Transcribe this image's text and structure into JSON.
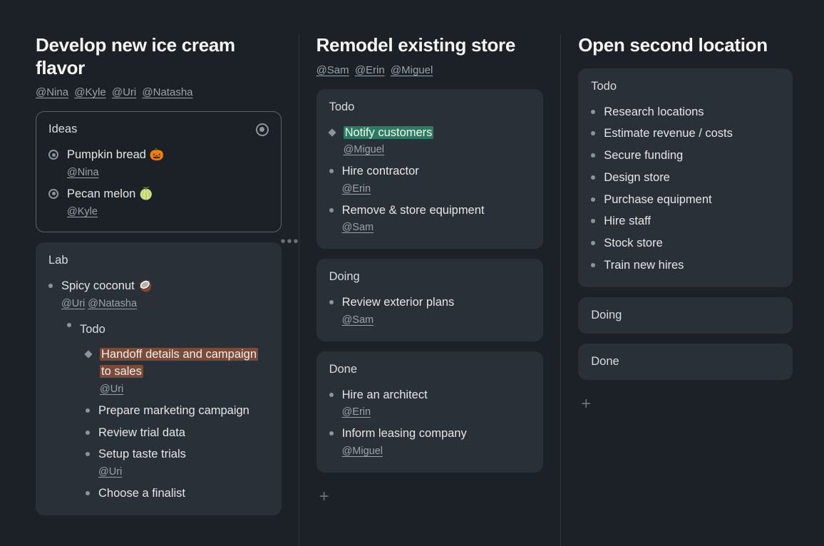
{
  "columns": [
    {
      "title": "Develop new ice cream flavor",
      "assignees": [
        "@Nina",
        "@Kyle",
        "@Uri",
        "@Natasha"
      ],
      "cards": [
        {
          "kind": "selected",
          "header": "Ideas",
          "header_focus": true,
          "items": [
            {
              "marker": "radio",
              "text": "Pumpkin bread 🎃",
              "assignees": [
                "@Nina"
              ]
            },
            {
              "marker": "radio",
              "text": "Pecan melon 🍈",
              "assignees": [
                "@Kyle"
              ]
            }
          ]
        },
        {
          "kind": "normal",
          "header": "Lab",
          "items": [
            {
              "marker": "bullet",
              "text": "Spicy coconut 🥥",
              "assignees": [
                "@Uri",
                "@Natasha"
              ],
              "children_header": "Todo",
              "children": [
                {
                  "marker": "diamond",
                  "text": "Handoff details and campaign to sales",
                  "highlight": "brown",
                  "assignees": [
                    "@Uri"
                  ]
                },
                {
                  "marker": "bullet",
                  "text": "Prepare marketing campaign"
                },
                {
                  "marker": "bullet",
                  "text": "Review trial data"
                },
                {
                  "marker": "bullet",
                  "text": "Setup taste trials",
                  "assignees": [
                    "@Uri"
                  ]
                },
                {
                  "marker": "bullet",
                  "text": "Choose a finalist"
                }
              ]
            }
          ]
        }
      ],
      "show_ellipsis": true
    },
    {
      "title": "Remodel existing store",
      "assignees": [
        "@Sam",
        "@Erin",
        "@Miguel"
      ],
      "cards": [
        {
          "kind": "normal",
          "header": "Todo",
          "items": [
            {
              "marker": "diamond",
              "text": "Notify customers",
              "highlight": "green",
              "assignees": [
                "@Miguel"
              ]
            },
            {
              "marker": "bullet",
              "text": "Hire contractor",
              "assignees": [
                "@Erin"
              ]
            },
            {
              "marker": "bullet",
              "text": "Remove & store equipment",
              "assignees": [
                "@Sam"
              ]
            }
          ]
        },
        {
          "kind": "normal",
          "header": "Doing",
          "items": [
            {
              "marker": "bullet",
              "text": "Review exterior plans",
              "assignees": [
                "@Sam"
              ]
            }
          ]
        },
        {
          "kind": "normal",
          "header": "Done",
          "items": [
            {
              "marker": "bullet",
              "text": "Hire an architect",
              "assignees": [
                "@Erin"
              ]
            },
            {
              "marker": "bullet",
              "text": "Inform leasing company",
              "assignees": [
                "@Miguel"
              ]
            }
          ]
        }
      ],
      "show_add": true
    },
    {
      "title": "Open second location",
      "assignees": [],
      "cards": [
        {
          "kind": "normal",
          "header": "Todo",
          "items": [
            {
              "marker": "bullet",
              "text": "Research locations"
            },
            {
              "marker": "bullet",
              "text": "Estimate revenue / costs"
            },
            {
              "marker": "bullet",
              "text": "Secure funding"
            },
            {
              "marker": "bullet",
              "text": "Design store"
            },
            {
              "marker": "bullet",
              "text": "Purchase equipment"
            },
            {
              "marker": "bullet",
              "text": "Hire staff"
            },
            {
              "marker": "bullet",
              "text": "Stock store"
            },
            {
              "marker": "bullet",
              "text": "Train new hires"
            }
          ]
        },
        {
          "kind": "normal",
          "header": "Doing",
          "items": []
        },
        {
          "kind": "normal",
          "header": "Done",
          "items": []
        }
      ],
      "show_add": true
    }
  ],
  "glyphs": {
    "add": "+",
    "ellipsis": "•••"
  }
}
